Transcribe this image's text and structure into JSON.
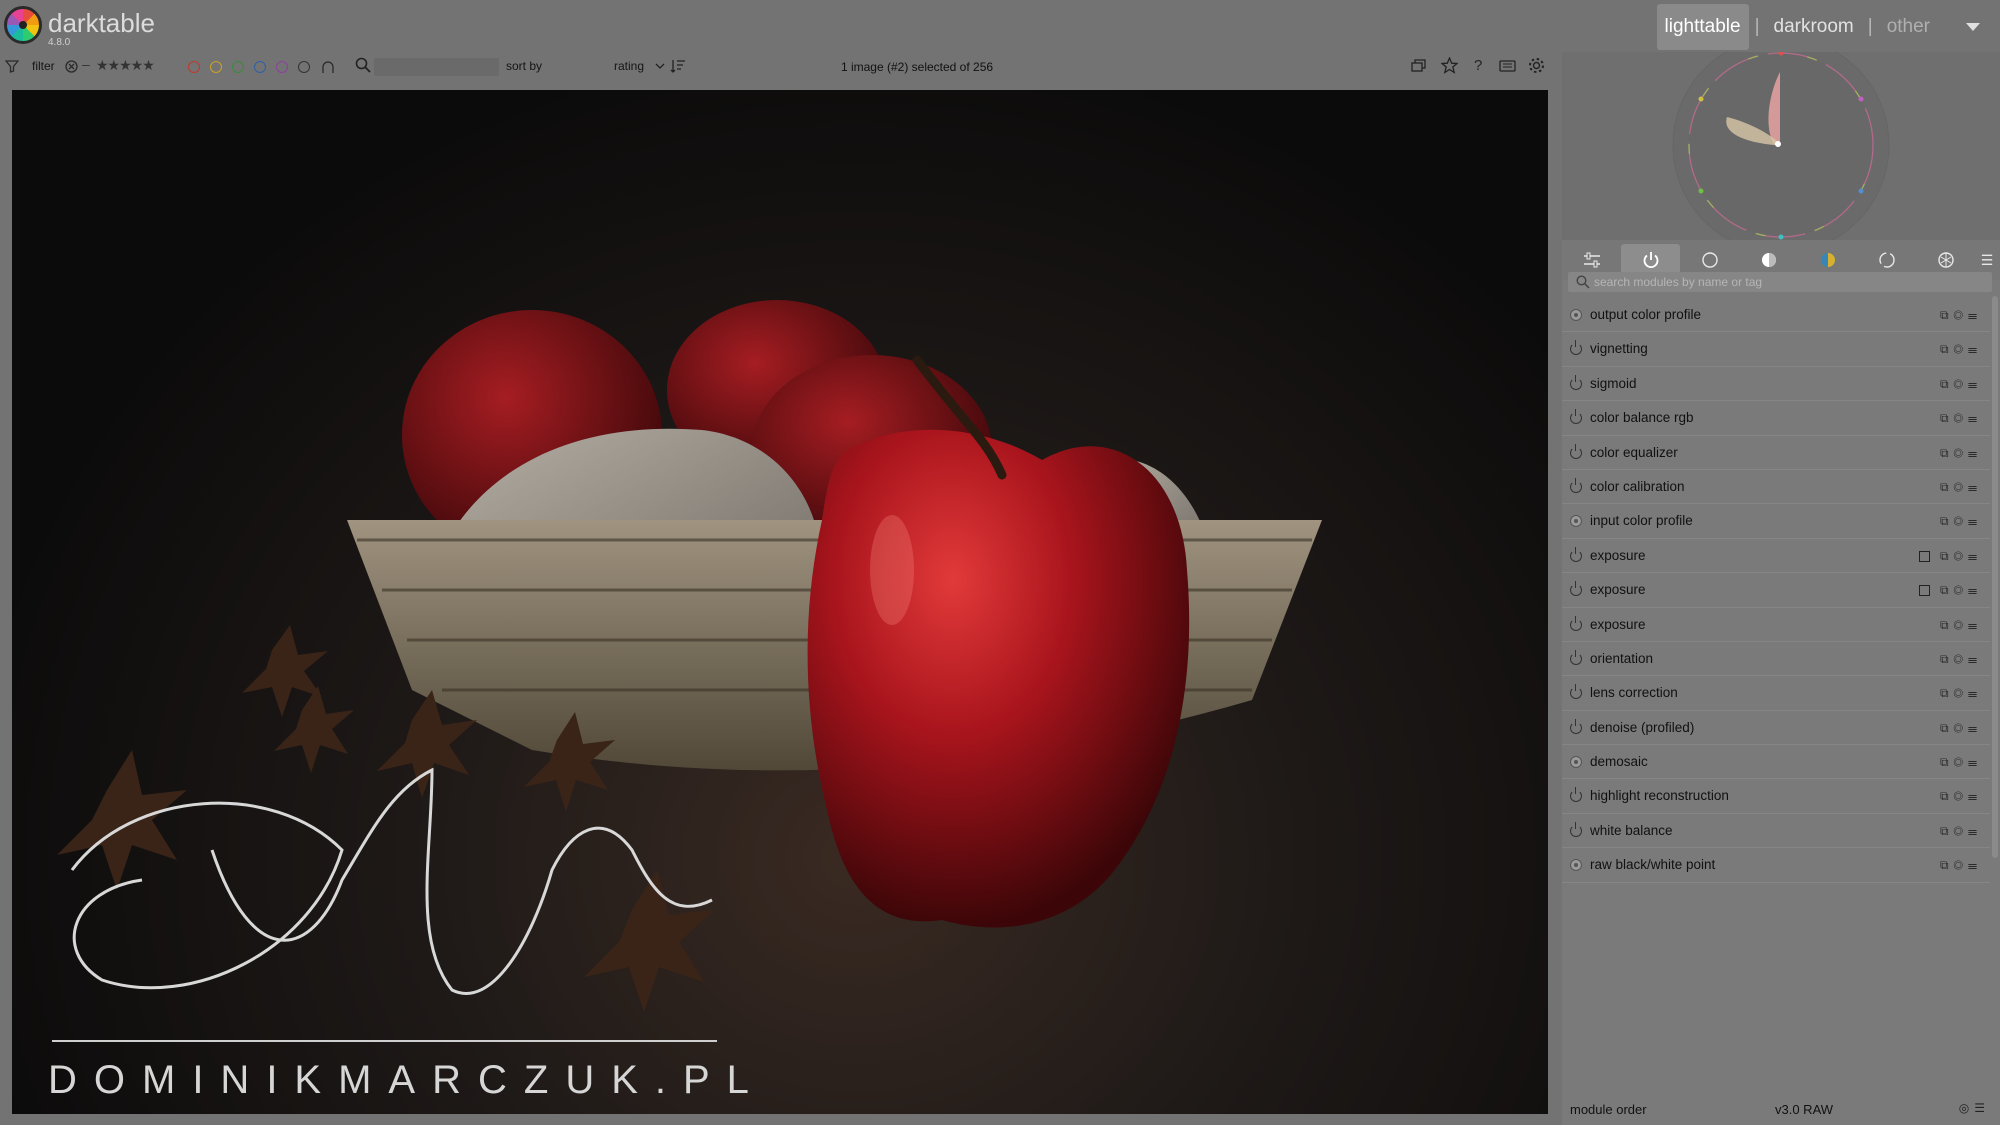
{
  "app": {
    "name": "darktable",
    "version": "4.8.0"
  },
  "views": [
    {
      "label": "lighttable",
      "active": true
    },
    {
      "label": "darkroom",
      "active": false
    },
    {
      "label": "other",
      "active": false
    }
  ],
  "toolbar": {
    "filter_label": "filter",
    "stars": "★★★★★",
    "sort_label": "sort by",
    "sort_value": "rating",
    "selection_text": "1 image (#2) selected of 256",
    "color_labels": [
      "#c0392b",
      "#c9a227",
      "#3c8a3c",
      "#2e5fa8",
      "#8e3fa0"
    ]
  },
  "photo": {
    "watermark_signature": "Dominik Marczuk",
    "watermark_text": "DOMINIKMARCZUK.PL"
  },
  "module_search": {
    "placeholder": "search modules by name or tag"
  },
  "modules": [
    {
      "label": "output color profile",
      "type": "always"
    },
    {
      "label": "vignetting",
      "type": "power"
    },
    {
      "label": "sigmoid",
      "type": "power"
    },
    {
      "label": "color balance rgb",
      "type": "power"
    },
    {
      "label": "color equalizer",
      "type": "power"
    },
    {
      "label": "color calibration",
      "type": "power"
    },
    {
      "label": "input color profile",
      "type": "always"
    },
    {
      "label": "exposure",
      "type": "power",
      "mask": true
    },
    {
      "label": "exposure",
      "type": "power",
      "mask": true
    },
    {
      "label": "exposure",
      "type": "power"
    },
    {
      "label": "orientation",
      "type": "power"
    },
    {
      "label": "lens correction",
      "type": "power"
    },
    {
      "label": "denoise (profiled)",
      "type": "power"
    },
    {
      "label": "demosaic",
      "type": "always"
    },
    {
      "label": "highlight reconstruction",
      "type": "power"
    },
    {
      "label": "white balance",
      "type": "power"
    },
    {
      "label": "raw black/white point",
      "type": "always"
    }
  ],
  "footer": {
    "module_order_label": "module order",
    "module_order_value": "v3.0 RAW"
  }
}
